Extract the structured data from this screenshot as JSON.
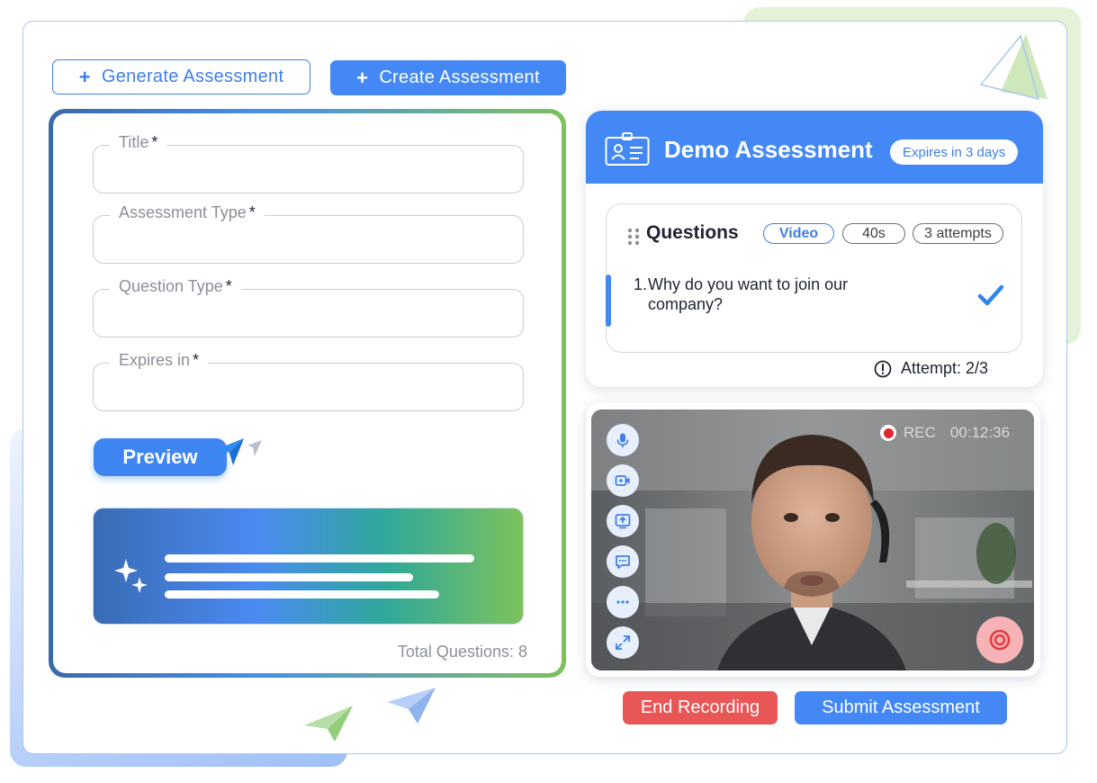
{
  "toolbar": {
    "generate_label": "Generate Assessment",
    "create_label": "Create Assessment"
  },
  "form": {
    "fields": [
      {
        "label": "Title",
        "required": "*"
      },
      {
        "label": "Assessment Type",
        "required": "*"
      },
      {
        "label": "Question Type",
        "required": "*"
      },
      {
        "label": "Expires in",
        "required": "*"
      }
    ],
    "preview_label": "Preview",
    "total_questions": "Total Questions: 8"
  },
  "assessment": {
    "title": "Demo Assessment",
    "expires": "Expires in 3 days",
    "questions_title": "Questions",
    "tags": {
      "type": "Video",
      "duration": "40s",
      "attempts": "3 attempts"
    },
    "question_number": "1.",
    "question_text": "Why do you want to join our company?",
    "attempt": "Attempt: 2/3"
  },
  "video": {
    "rec_label": "REC",
    "rec_time": "00:12:36",
    "controls": [
      "mic-icon",
      "camera-icon",
      "upload-icon",
      "chat-icon",
      "more-icon",
      "expand-icon"
    ]
  },
  "actions": {
    "end_label": "End Recording",
    "submit_label": "Submit Assessment"
  },
  "colors": {
    "primary": "#4388f4",
    "danger": "#e85656",
    "accent_green": "#7cc25c"
  }
}
